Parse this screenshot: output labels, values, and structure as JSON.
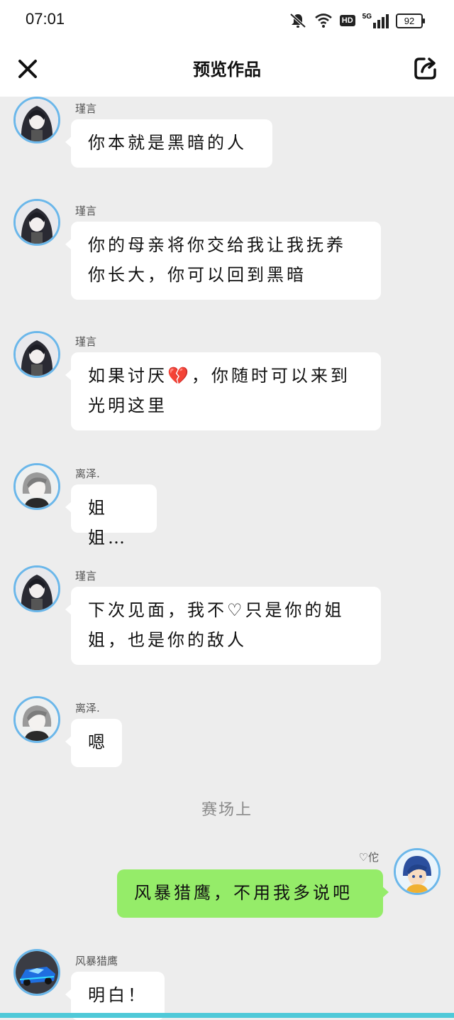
{
  "status_bar": {
    "time": "07:01",
    "battery": "92",
    "network": "5G",
    "hd": "HD"
  },
  "header": {
    "title": "预览作品"
  },
  "messages": [
    {
      "sender": "瑾言",
      "text": "你本就是黑暗的人",
      "side": "left",
      "avatar": "dark-hair-girl"
    },
    {
      "sender": "瑾言",
      "text": "你的母亲将你交给我让我抚养你长大，你可以回到黑暗",
      "side": "left",
      "avatar": "dark-hair-girl"
    },
    {
      "sender": "瑾言",
      "text": "如果讨厌💔，你随时可以来到光明这里",
      "side": "left",
      "avatar": "dark-hair-girl"
    },
    {
      "sender": "离泽.",
      "text": "姐姐…",
      "side": "left",
      "avatar": "grey-hair-boy"
    },
    {
      "sender": "瑾言",
      "text": "下次见面，我不♡只是你的姐姐，也是你的敌人",
      "side": "left",
      "avatar": "dark-hair-girl"
    },
    {
      "sender": "离泽.",
      "text": "嗯",
      "side": "left",
      "avatar": "grey-hair-boy"
    },
    {
      "sender": "♡佗",
      "text": "风暴猎鹰，不用我多说吧",
      "side": "right",
      "avatar": "blue-hair-boy"
    },
    {
      "sender": "风暴猎鹰",
      "text": "明白！",
      "side": "left",
      "avatar": "blue-race-car"
    }
  ],
  "scene_marker": "赛场上",
  "colors": {
    "accent": "#6bb7ea",
    "self_bubble": "#95ec69",
    "background": "#ededed",
    "bottom_bar": "#4fc9d8"
  }
}
